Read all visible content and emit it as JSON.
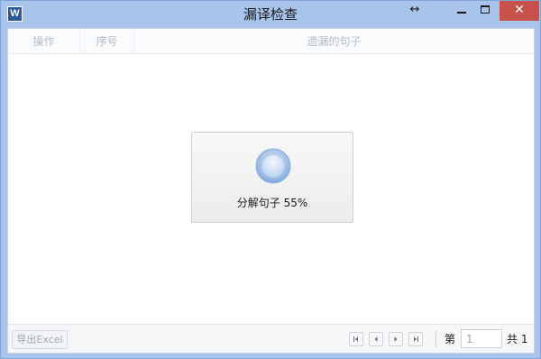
{
  "window": {
    "title": "漏译检查",
    "app_icon_letter": "W",
    "resize_glyph": "↔",
    "close_glyph": "✕"
  },
  "grid": {
    "columns": [
      "操作",
      "序号",
      "遗漏的句子"
    ]
  },
  "loading": {
    "label": "分解句子",
    "progress_text": "55%",
    "progress": 0.55
  },
  "footer": {
    "export_label": "导出Excel",
    "page_prefix": "第",
    "page_value": "1",
    "total_text": "共 1"
  },
  "colors": {
    "titlebar": "#a9c4ea",
    "close_button": "#c7504a"
  }
}
